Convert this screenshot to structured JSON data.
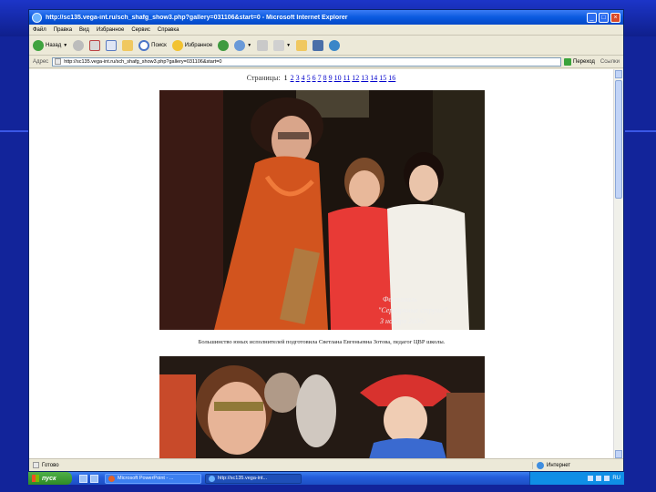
{
  "window": {
    "title": "http://sc135.vega-int.ru/sch_shafg_show3.php?gallery=031106&start=0 - Microsoft Internet Explorer"
  },
  "menu": [
    "Файл",
    "Правка",
    "Вид",
    "Избранное",
    "Сервис",
    "Справка"
  ],
  "toolbar": {
    "back_label": "Назад",
    "search_label": "Поиск",
    "favorites_label": "Избранное"
  },
  "address": {
    "label": "Адрес",
    "url": "http://sc135.vega-int.ru/sch_shafg_show3.php?gallery=031106&start=0",
    "go_label": "Переход",
    "links_label": "Ссылки"
  },
  "page": {
    "pages_label": "Страницы:",
    "current_page": "1",
    "page_links": [
      "2",
      "3",
      "4",
      "5",
      "6",
      "7",
      "8",
      "9",
      "10",
      "11",
      "12",
      "13",
      "14",
      "15",
      "16"
    ],
    "caption": "Большинство юных исполнителей подготовила Светлана Евгеньевна Зотова, педагог ЦВР школы."
  },
  "status": {
    "text": "Готово",
    "zone": "Интернет"
  },
  "taskbar": {
    "start_label": "пуск",
    "tasks": [
      "Microsoft PowerPoint - ...",
      "http://sc135.vega-int..."
    ],
    "clock": "RU"
  }
}
